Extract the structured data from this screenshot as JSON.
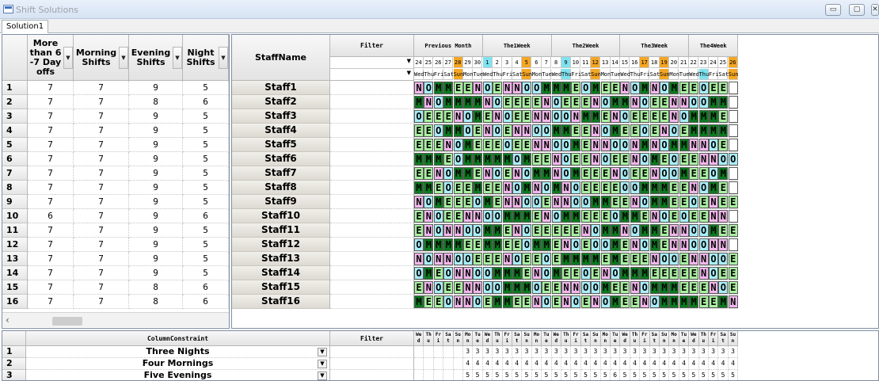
{
  "window": {
    "title": "Shift Solutions",
    "minimize_label": "▭",
    "maximize_label": "▢",
    "close_label": "✕"
  },
  "tabs": [
    {
      "label": "Solution1"
    }
  ],
  "left_grid": {
    "columns": [
      {
        "label": "More than 6 -7 Day offs"
      },
      {
        "label": "Morning Shifts"
      },
      {
        "label": "Evening Shifts"
      },
      {
        "label": "Night Shifts"
      }
    ],
    "rows": [
      {
        "num": "1",
        "values": [
          "7",
          "7",
          "9",
          "5"
        ]
      },
      {
        "num": "2",
        "values": [
          "7",
          "7",
          "8",
          "6"
        ]
      },
      {
        "num": "3",
        "values": [
          "7",
          "7",
          "9",
          "5"
        ]
      },
      {
        "num": "4",
        "values": [
          "7",
          "7",
          "9",
          "5"
        ]
      },
      {
        "num": "5",
        "values": [
          "7",
          "7",
          "9",
          "5"
        ]
      },
      {
        "num": "6",
        "values": [
          "7",
          "7",
          "9",
          "5"
        ]
      },
      {
        "num": "7",
        "values": [
          "7",
          "7",
          "9",
          "5"
        ]
      },
      {
        "num": "8",
        "values": [
          "7",
          "7",
          "9",
          "5"
        ]
      },
      {
        "num": "9",
        "values": [
          "7",
          "7",
          "9",
          "5"
        ]
      },
      {
        "num": "10",
        "values": [
          "6",
          "7",
          "9",
          "6"
        ]
      },
      {
        "num": "11",
        "values": [
          "7",
          "7",
          "9",
          "5"
        ]
      },
      {
        "num": "12",
        "values": [
          "7",
          "7",
          "9",
          "5"
        ]
      },
      {
        "num": "13",
        "values": [
          "7",
          "7",
          "9",
          "5"
        ]
      },
      {
        "num": "14",
        "values": [
          "7",
          "7",
          "9",
          "5"
        ]
      },
      {
        "num": "15",
        "values": [
          "7",
          "7",
          "8",
          "6"
        ]
      },
      {
        "num": "16",
        "values": [
          "7",
          "7",
          "8",
          "6"
        ]
      }
    ],
    "scroll_left_label": "‹"
  },
  "right_grid": {
    "staff_header": "StaffName",
    "filter_header": "Filter",
    "groups": [
      "Previous Month",
      "The1Week",
      "The2Week",
      "The3Week",
      "The4Week"
    ],
    "days": [
      "24",
      "25",
      "26",
      "27",
      "28",
      "29",
      "30",
      "1",
      "2",
      "3",
      "4",
      "5",
      "6",
      "7",
      "8",
      "9",
      "10",
      "11",
      "12",
      "13",
      "14",
      "15",
      "16",
      "17",
      "18",
      "19",
      "20",
      "21",
      "22",
      "23",
      "24",
      "25",
      "26"
    ],
    "weekdays": [
      "Wed",
      "Thu",
      "Fri",
      "Sat",
      "Sun",
      "Mon",
      "Tue",
      "Wed",
      "Thu",
      "Fri",
      "Sat",
      "Sun",
      "Mon",
      "Tue",
      "Wed",
      "Thu",
      "Fri",
      "Sat",
      "Sun",
      "Mon",
      "Tue",
      "Wed",
      "Thu",
      "Fri",
      "Sat",
      "Sun",
      "Mon",
      "Tue",
      "Wed",
      "Thu",
      "Fri",
      "Sat",
      "Sun"
    ],
    "staff": [
      {
        "name": "Staff1",
        "shifts": "NOMMEENOENNOOMMMEOMEENOMNOMEEOEE"
      },
      {
        "name": "Staff2",
        "shifts": "MNOMMMMNOEEEENOEEENOMMNOEENNOOMM"
      },
      {
        "name": "Staff3",
        "shifts": "OEEENOMENOEENNOONMMENOEEEENOMMME"
      },
      {
        "name": "Staff4",
        "shifts": "EEOMMOENOENNOOMMEENOMEEOENOEMMMM"
      },
      {
        "name": "Staff5",
        "shifts": "EEENOMEEEOEENNOOMENNOONMNOMMNNOE"
      },
      {
        "name": "Staff6",
        "shifts": "MMMEOMMMMMOMEENOEENOEENOMEOEENNOO"
      },
      {
        "name": "Staff7",
        "shifts": "EENOMMENOENOMMNOMEEENOEENOOMEEOM"
      },
      {
        "name": "Staff8",
        "shifts": "MMEOEEMEENOMNOMNOEEEEOOMMMEENOME"
      },
      {
        "name": "Staff9",
        "shifts": "NOMEEEOMENNOOENNOOMMEENOMMEEOENEE"
      },
      {
        "name": "Staff10",
        "shifts": "ENOEENNOOMMMENOMMEEEOMMENOEOEENN"
      },
      {
        "name": "Staff11",
        "shifts": "ENONNOOMMENOEEEEENOMMNOMMENNOOMEE"
      },
      {
        "name": "Staff12",
        "shifts": "OMMMMEEMMEEOMMENOEOOMENOMENNOONN"
      },
      {
        "name": "Staff13",
        "shifts": "NONNOOEEENOEEOEMMMMEMEEENOOENNOOE"
      },
      {
        "name": "Staff14",
        "shifts": "OMEONNOOMMMENOMEEOENOMMMEEEEENOEE"
      },
      {
        "name": "Staff15",
        "shifts": "ENOEENNOOMMMOEENNOOMEENOMMMEEENOE"
      },
      {
        "name": "Staff16",
        "shifts": "MEEONNOEMMEENOENOENOMEENOMMMMEEMNE"
      }
    ]
  },
  "bottom_grid": {
    "header": "ColumnConstraint",
    "filter_header": "Filter",
    "weekday_abbr": [
      "We d",
      "Th u",
      "Fr i",
      "Sa t",
      "Su n",
      "Mo n",
      "Tu e",
      "We d",
      "Th u",
      "Fr i",
      "Sa t",
      "Su n",
      "Mo n",
      "Tu e",
      "We d",
      "Th u",
      "Fr i",
      "Sa t",
      "Su n",
      "Mo n",
      "Tu e",
      "We d",
      "Th u",
      "Fr i",
      "Sa t",
      "Su n",
      "Mo n",
      "Tu e",
      "We d",
      "Th u",
      "Fr i",
      "Sa t",
      "Su n"
    ],
    "rows": [
      {
        "num": "1",
        "label": "Three Nights",
        "values": [
          "",
          "",
          "",
          "",
          "",
          "3",
          "3",
          "3",
          "3",
          "3",
          "3",
          "3",
          "3",
          "3",
          "3",
          "3",
          "3",
          "3",
          "3",
          "3",
          "3",
          "3",
          "3",
          "3",
          "3",
          "3",
          "3",
          "3",
          "3",
          "3",
          "3",
          "3",
          "3"
        ]
      },
      {
        "num": "2",
        "label": "Four Mornings",
        "values": [
          "",
          "",
          "",
          "",
          "",
          "4",
          "4",
          "4",
          "4",
          "4",
          "4",
          "4",
          "4",
          "4",
          "4",
          "4",
          "4",
          "4",
          "4",
          "4",
          "4",
          "4",
          "4",
          "4",
          "4",
          "4",
          "4",
          "4",
          "4",
          "4",
          "4",
          "4",
          "4"
        ]
      },
      {
        "num": "3",
        "label": "Five Evenings",
        "values": [
          "",
          "",
          "",
          "",
          "",
          "5",
          "5",
          "5",
          "5",
          "5",
          "5",
          "5",
          "5",
          "5",
          "5",
          "5",
          "5",
          "5",
          "5",
          "5",
          "6",
          "5",
          "5",
          "5",
          "5",
          "5",
          "5",
          "5",
          "5",
          "5",
          "5",
          "5",
          "5"
        ]
      }
    ]
  },
  "colors": {
    "morning": "#0a7a1e",
    "night": "#f2b6ec",
    "evening": "#a8f0a0",
    "off": "#a8eef8",
    "weekend_day": "#f5a623",
    "today": "#7fe3ef"
  }
}
